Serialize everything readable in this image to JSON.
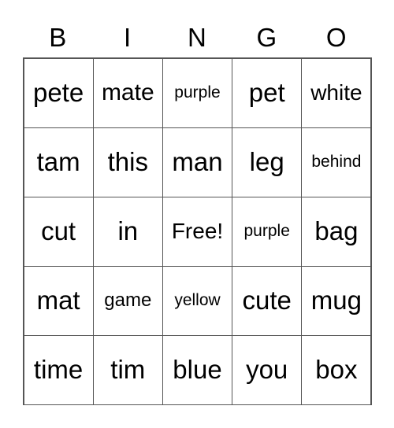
{
  "header": [
    "B",
    "I",
    "N",
    "G",
    "O"
  ],
  "cells": [
    [
      "pete",
      "mate",
      "purple",
      "pet",
      "white"
    ],
    [
      "tam",
      "this",
      "man",
      "leg",
      "behind"
    ],
    [
      "cut",
      "in",
      "Free!",
      "purple",
      "bag"
    ],
    [
      "mat",
      "game",
      "yellow",
      "cute",
      "mug"
    ],
    [
      "time",
      "tim",
      "blue",
      "you",
      "box"
    ]
  ]
}
